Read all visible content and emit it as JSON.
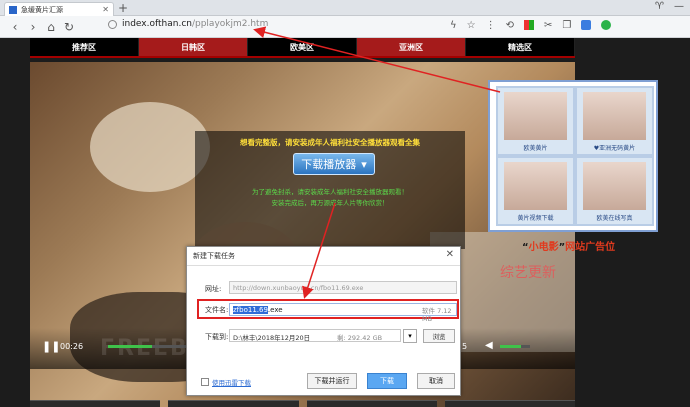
{
  "browser": {
    "tab_title": "急缓黄片汇源",
    "address_host": "index.ofthan.cn",
    "address_path": "/pplayokjm2.htm",
    "colors": {
      "accent": "#e02222",
      "nav_red": "#a51b1b"
    }
  },
  "site_menu": {
    "items": [
      {
        "label": "推荐区",
        "active": false
      },
      {
        "label": "日韩区",
        "active": true
      },
      {
        "label": "欧美区",
        "active": false
      },
      {
        "label": "亚洲区",
        "active": true
      },
      {
        "label": "精选区",
        "active": false
      }
    ]
  },
  "overlay": {
    "title": "想看完整版，请安装成年人福利社安全播放器观看全集",
    "button_label": "下载播放器",
    "line1": "为了避免封杀，请安装成年人福利社安全播放器观看！",
    "line2": "安装完成后，再万源成年人片等你欣赏！"
  },
  "ad": {
    "cells": [
      {
        "caption": "欧美黄片"
      },
      {
        "caption": "♥亚洲无码黄片"
      },
      {
        "caption": "黄片视频下载"
      },
      {
        "caption": "欧美在线写真"
      }
    ],
    "label_quote_open": "“",
    "label_main": "小电影",
    "label_quote_close": "”",
    "label_rest": "网站广告位",
    "stray_text": "综艺更新"
  },
  "dialog": {
    "title": "新建下载任务",
    "url_label": "网址:",
    "url_value": "http://down.xunbaoyun.cn/fbo11.69.exe",
    "filename_label": "文件名:",
    "filename_selected": "zfbo11.69",
    "filename_ext": ".exe",
    "file_size": "软件 7.12 MB",
    "saveto_label": "下载到:",
    "saveto_value": "D:\\林丰\\2018年12月20日",
    "disk_free": "剩: 292.42 GB",
    "browse_label": "浏览",
    "thunder_link": "使用迅雷下载",
    "btn_download_run": "下载并运行",
    "btn_download": "下载",
    "btn_cancel": "取消"
  },
  "player": {
    "time": "00:26",
    "progress": 0.55,
    "volume": 0.7,
    "right_time": "5",
    "watermark": "FREEBUF"
  }
}
